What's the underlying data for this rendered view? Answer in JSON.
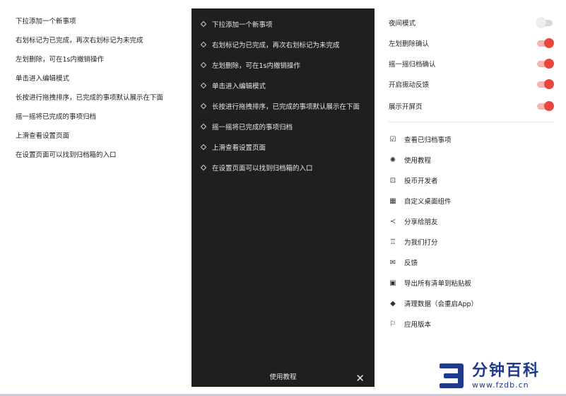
{
  "left_list": {
    "items": [
      "下拉添加一个新事项",
      "右划标记为已完成，再次右划标记为未完成",
      "左划删除，可在1s内撤销操作",
      "单击进入编辑模式",
      "长按进行拖拽排序，已完成的事项默认展示在下面",
      "摇一摇将已完成的事项归档",
      "上滑查看设置页面",
      "在设置页面可以找到归档箱的入口"
    ]
  },
  "tutorial_panel": {
    "items": [
      "下拉添加一个新事项",
      "右划标记为已完成，再次右划标记为未完成",
      "左划删除，可在1s内撤销操作",
      "单击进入编辑模式",
      "长按进行拖拽排序，已完成的事项默认展示在下面",
      "摇一摇将已完成的事项归档",
      "上滑查看设置页面",
      "在设置页面可以找到归档箱的入口"
    ],
    "footer_label": "使用教程",
    "close_glyph": "✕"
  },
  "settings": {
    "toggles": [
      {
        "label": "夜间模式",
        "on": false
      },
      {
        "label": "左划删除确认",
        "on": true
      },
      {
        "label": "摇一摇归档确认",
        "on": true
      },
      {
        "label": "开启振动反馈",
        "on": true
      },
      {
        "label": "展示开屏页",
        "on": true
      }
    ],
    "menu": [
      {
        "label": "查看已归档事项",
        "icon": "archive-check-icon",
        "glyph": "☑"
      },
      {
        "label": "使用教程",
        "icon": "lightbulb-icon",
        "glyph": "✺"
      },
      {
        "label": "投币开发者",
        "icon": "coin-icon",
        "glyph": "⊡"
      },
      {
        "label": "自定义桌面组件",
        "icon": "grid-icon",
        "glyph": "▦"
      },
      {
        "label": "分享给朋友",
        "icon": "share-icon",
        "glyph": "≺"
      },
      {
        "label": "为我们打分",
        "icon": "trophy-icon",
        "glyph": "♖"
      },
      {
        "label": "反馈",
        "icon": "mail-icon",
        "glyph": "✉"
      },
      {
        "label": "导出所有清单到粘贴板",
        "icon": "clipboard-icon",
        "glyph": "▣"
      },
      {
        "label": "清理数据（会重启App）",
        "icon": "eraser-icon",
        "glyph": "◆"
      },
      {
        "label": "应用版本",
        "icon": "flag-icon",
        "glyph": "⚐"
      }
    ],
    "accent_color": "#e8463e"
  },
  "watermark": {
    "name": "分钟百科",
    "url": "www.fzdb.cn"
  }
}
